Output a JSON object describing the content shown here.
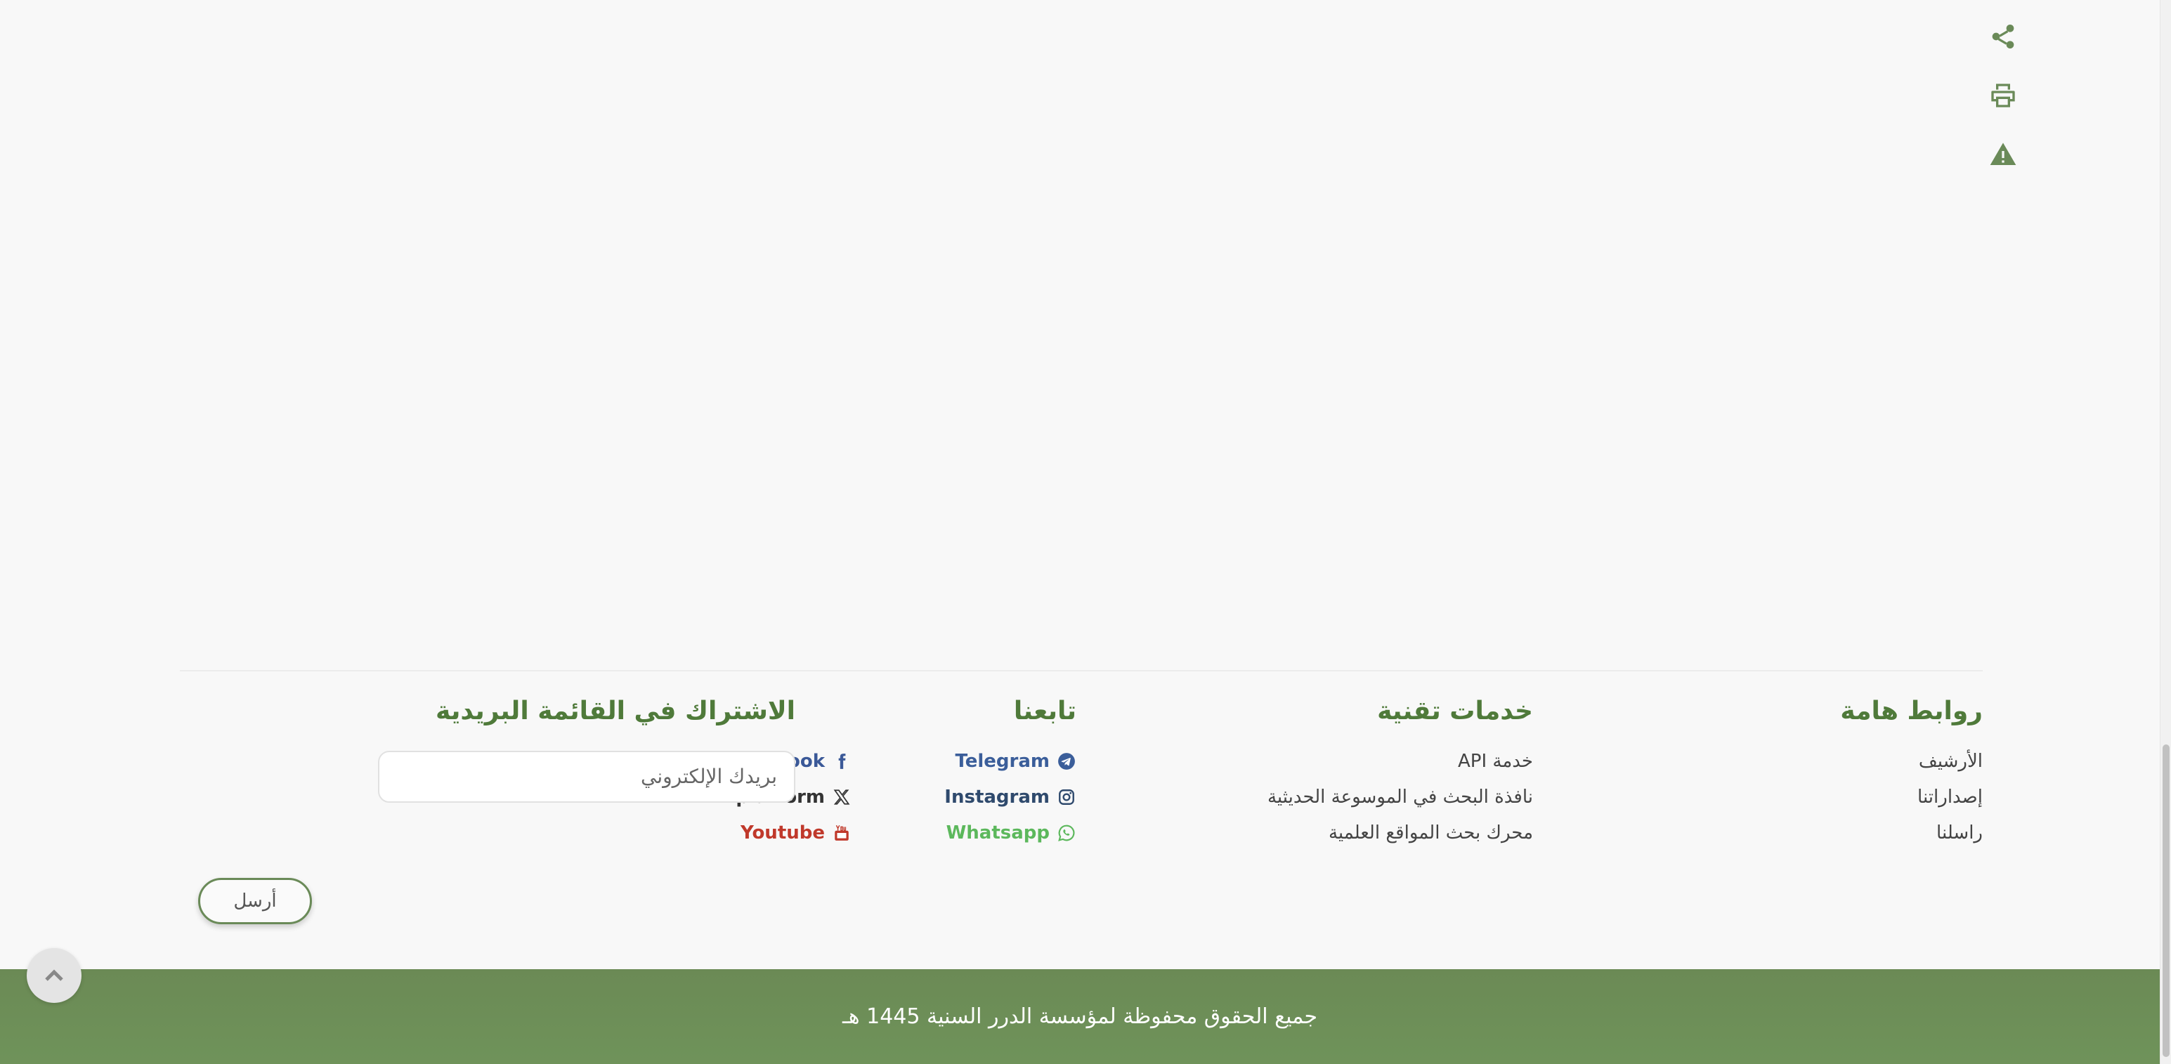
{
  "side_actions": [
    {
      "name": "share-icon"
    },
    {
      "name": "print-icon"
    },
    {
      "name": "warning-icon"
    }
  ],
  "footer": {
    "important_links": {
      "title": "روابط هامة",
      "items": [
        "الأرشيف",
        "إصداراتنا",
        "راسلنا"
      ]
    },
    "tech_services": {
      "title": "خدمات تقنية",
      "items": [
        "خدمة API",
        "نافذة البحث في الموسوعة الحديثية",
        "محرك بحث المواقع العلمية"
      ]
    },
    "follow_us": {
      "title": "تابعنا",
      "items": [
        {
          "label": "Telegram",
          "icon": "telegram-icon",
          "color": "#3b5e9a"
        },
        {
          "label": "Facebook",
          "icon": "facebook-icon",
          "color": "#3b5998"
        },
        {
          "label": "Instagram",
          "icon": "instagram-icon",
          "color": "#2f4a6d"
        },
        {
          "label": "X platform",
          "icon": "x-icon",
          "color": "#333333"
        },
        {
          "label": "Whatsapp",
          "icon": "whatsapp-icon",
          "color": "#5cb85c"
        },
        {
          "label": "Youtube",
          "icon": "youtube-icon",
          "color": "#c0392b"
        }
      ]
    },
    "subscribe": {
      "title": "الاشتراك في القائمة البريدية",
      "email_placeholder": "بريدك الإلكتروني",
      "email_value": "",
      "send_label": "أرسل"
    }
  },
  "copyright": "جميع الحقوق محفوظة لمؤسسة الدرر السنية 1445 هـ",
  "colors": {
    "accent_green": "#4f7a3a",
    "footer_bar": "#6b8a55"
  }
}
